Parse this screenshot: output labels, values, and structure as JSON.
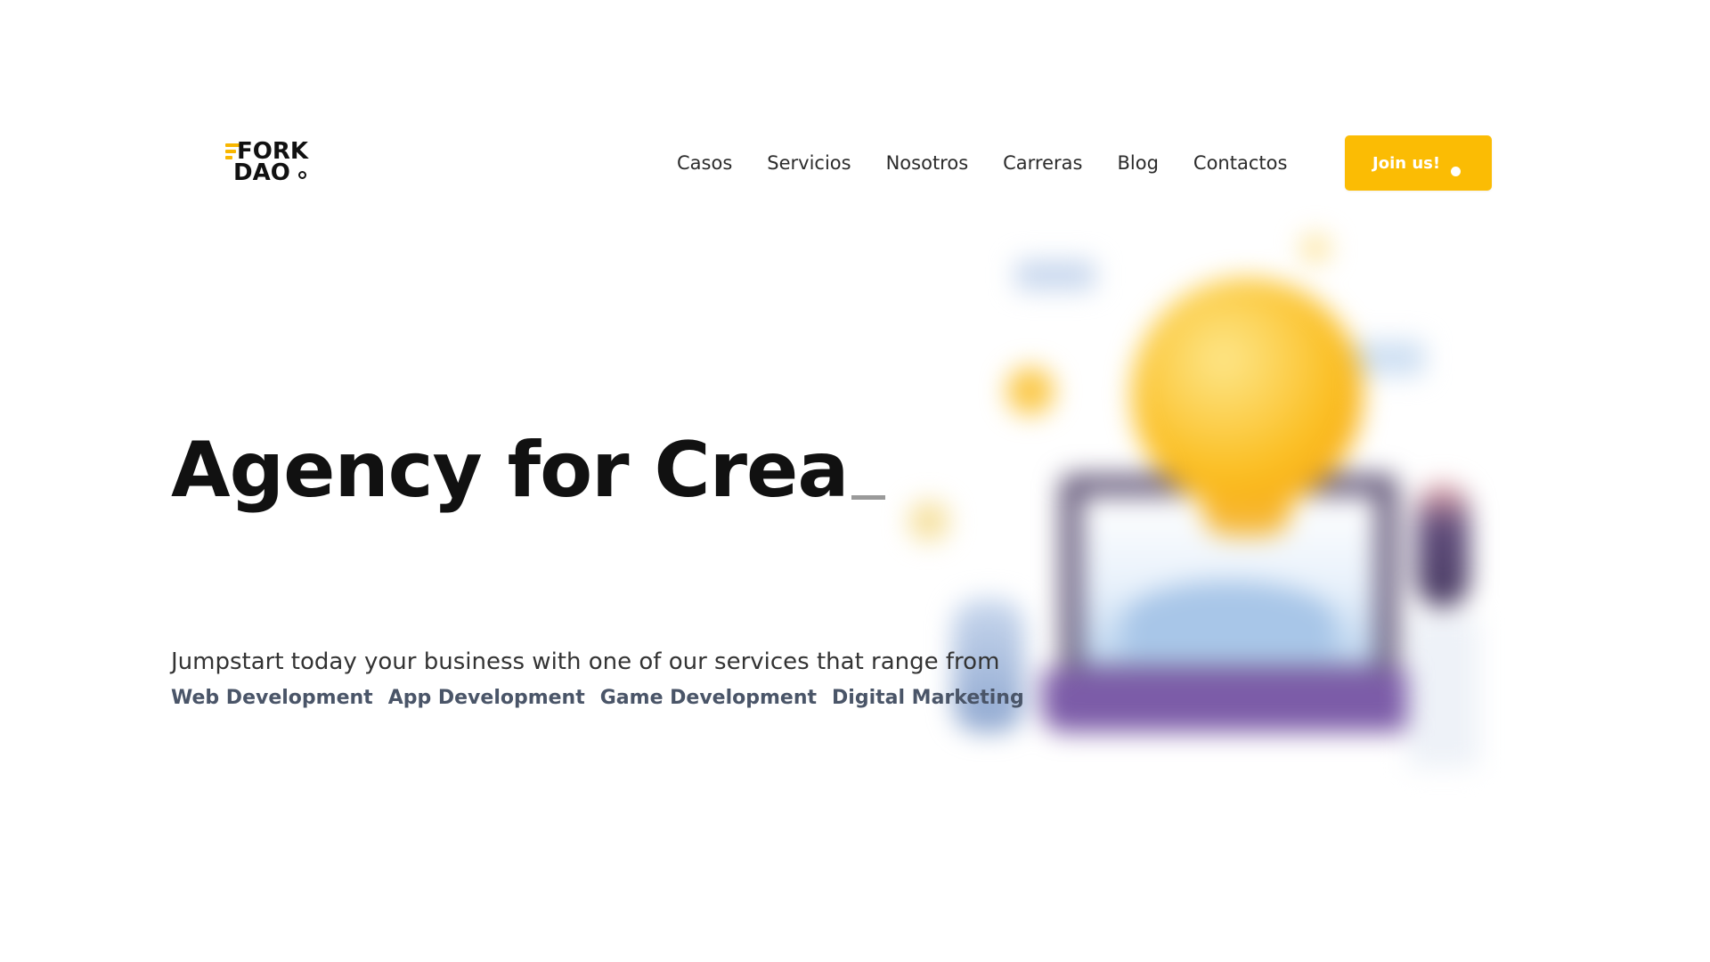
{
  "brand": {
    "logo_line_1": "FORK",
    "logo_line_2": "DAO",
    "accent_color": "#fbbc04"
  },
  "nav": {
    "items": [
      {
        "label": "Casos"
      },
      {
        "label": "Servicios"
      },
      {
        "label": "Nosotros"
      },
      {
        "label": "Carreras"
      },
      {
        "label": "Blog"
      },
      {
        "label": "Contactos"
      }
    ],
    "cta_label": "Join us!"
  },
  "hero": {
    "title_typed": "Agency for Crea",
    "description": "Jumpstart today your business with one of our services that range from",
    "services": [
      {
        "label": "Web Development"
      },
      {
        "label": "App Development"
      },
      {
        "label": "Game Development"
      },
      {
        "label": "Digital Marketing"
      }
    ]
  },
  "illustration": {
    "icon": "lightbulb-laptop-illustration",
    "state": "blurred"
  }
}
